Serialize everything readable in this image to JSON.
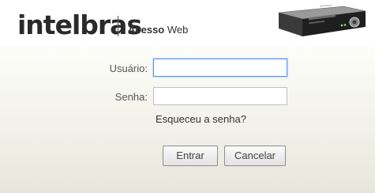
{
  "header": {
    "brand": "intelbras",
    "product_prefix": "Acesso",
    "product_suffix": " Web",
    "device_image": "dvr-recorder-icon"
  },
  "login": {
    "username_label": "Usuário:",
    "username_value": "",
    "password_label": "Senha:",
    "password_value": "",
    "forgot_link": "Esqueceu a senha?",
    "login_button": "Entrar",
    "cancel_button": "Cancelar"
  },
  "colors": {
    "focus_border": "#4d90fe",
    "background_top": "#fdfdf9",
    "background_bottom": "#e6e6dc"
  }
}
